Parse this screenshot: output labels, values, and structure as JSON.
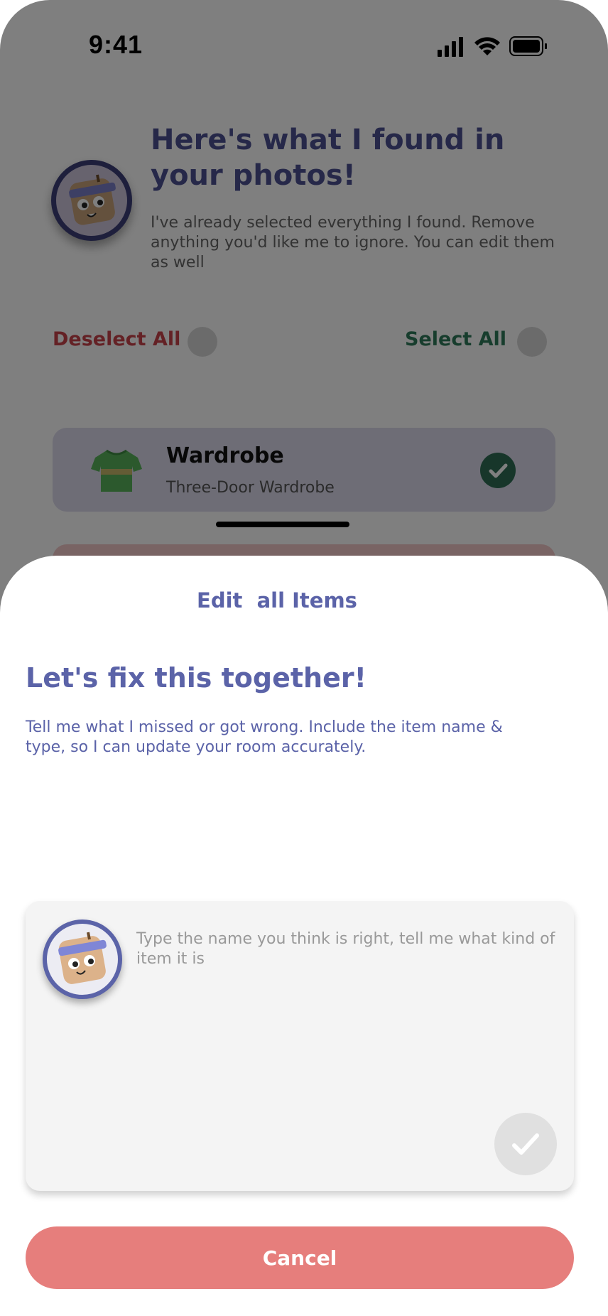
{
  "status_bar": {
    "time": "9:41"
  },
  "header": {
    "title": "Here's what I found in your photos!",
    "description": "I've already selected everything I found. Remove anything you'd like me to ignore. You can edit them as well"
  },
  "selection": {
    "deselect_label": "Deselect All",
    "select_label": "Select All"
  },
  "items": [
    {
      "title": "Wardrobe",
      "subtitle": "Three-Door Wardrobe",
      "selected": true
    }
  ],
  "sheet": {
    "title": "Edit  all Items",
    "heading": "Let's fix this together!",
    "description": "Tell me what I missed or got wrong. Include the item name & type, so I can update your room accurately.",
    "input_placeholder": "Type the name you think is right, tell me what kind of item it is",
    "cancel_label": "Cancel"
  },
  "colors": {
    "accent": "#5b63a8",
    "deselect": "#c9424a",
    "select": "#2f7a5b",
    "cancel": "#e67e7c"
  }
}
